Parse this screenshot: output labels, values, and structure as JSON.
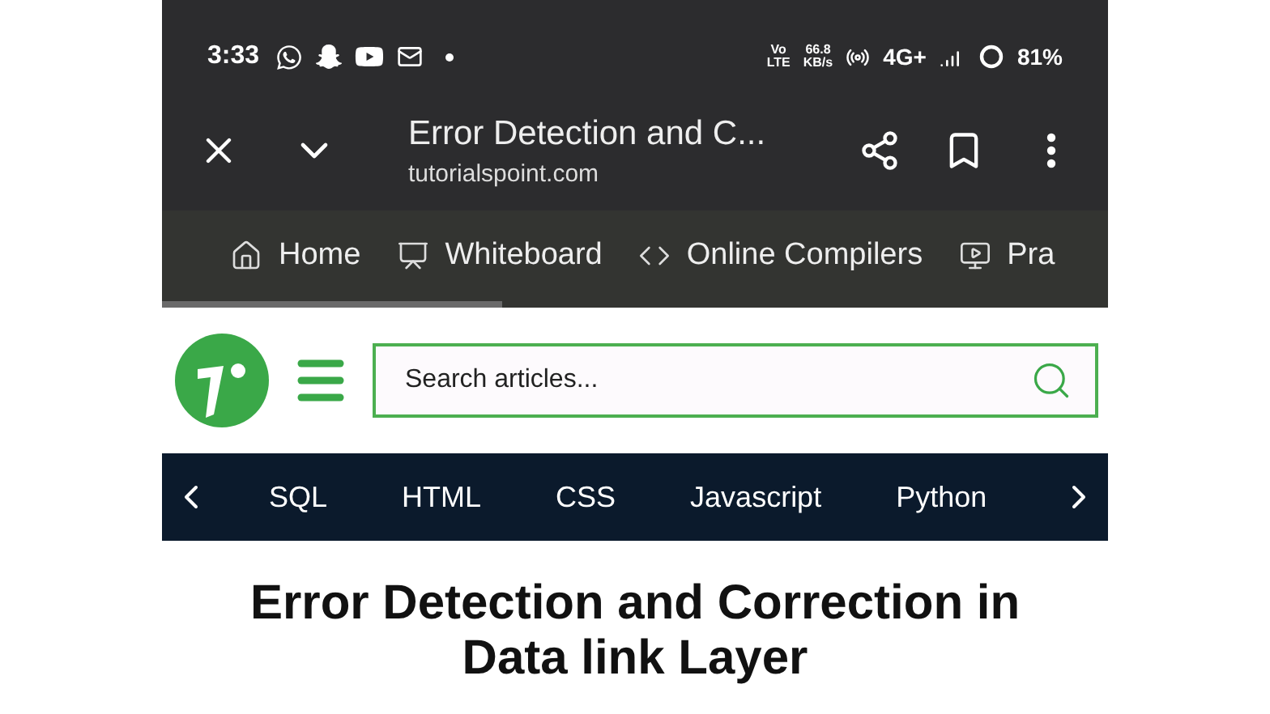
{
  "status_bar": {
    "time": "3:33",
    "volte": [
      "Vo",
      "LTE"
    ],
    "speed": [
      "66.8",
      "KB/s"
    ],
    "network": "4G+",
    "battery": "81%"
  },
  "browser": {
    "title": "Error Detection and C...",
    "url": "tutorialspoint.com",
    "load_progress": {
      "level": 0.36
    }
  },
  "bookmarks": [
    {
      "label": "Home",
      "kind": "home"
    },
    {
      "label": "Whiteboard",
      "kind": "whiteboard"
    },
    {
      "label": "Online Compilers",
      "kind": "code"
    },
    {
      "label": "Pra",
      "kind": "practice"
    }
  ],
  "search": {
    "placeholder": "Search articles..."
  },
  "nav": [
    {
      "label": "SQL"
    },
    {
      "label": "HTML"
    },
    {
      "label": "CSS"
    },
    {
      "label": "Javascript"
    },
    {
      "label": "Python"
    }
  ],
  "heading": "Error Detection and Correction in Data link Layer"
}
